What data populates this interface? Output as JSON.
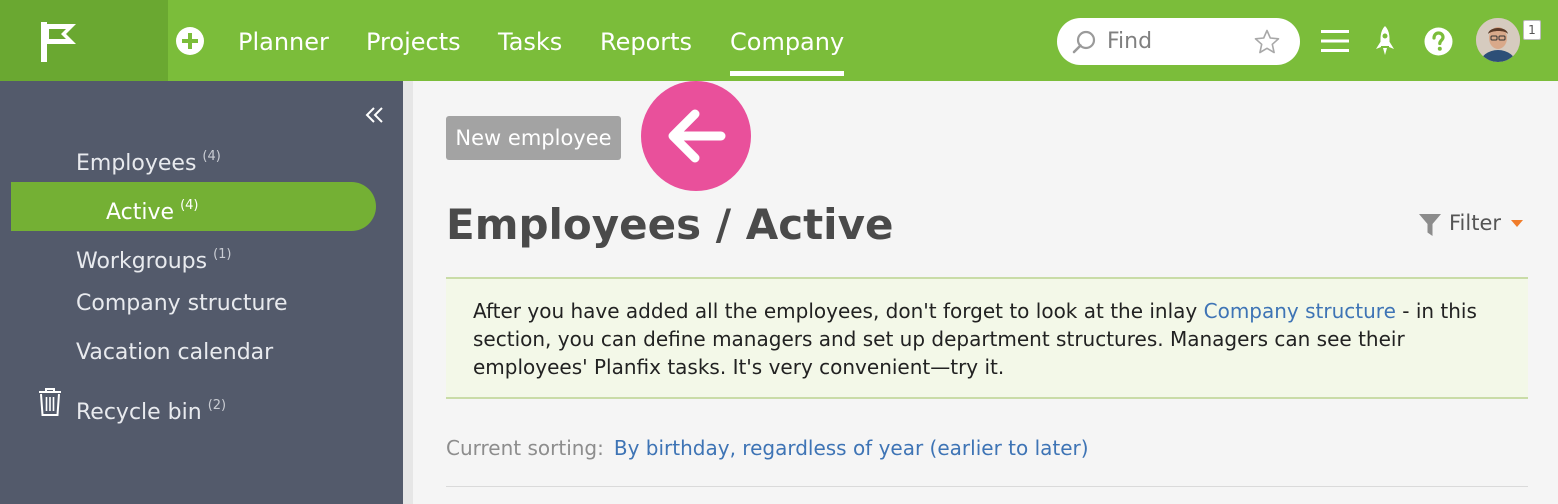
{
  "topbar": {
    "nav": [
      "Planner",
      "Projects",
      "Tasks",
      "Reports",
      "Company"
    ],
    "active_nav": "Company",
    "search_placeholder": "Find",
    "notification_count": "1",
    "colors": {
      "bar": "#7bbd3a",
      "logo_block": "#6aa831"
    }
  },
  "icons": {
    "logo": "planfix-flag-icon",
    "plus": "add-circle-icon",
    "search": "search-icon",
    "favorite": "star-icon",
    "menu": "hamburger-menu-icon",
    "launch": "rocket-icon",
    "help": "help-icon",
    "collapse": "double-chevron-left-icon",
    "trash": "trash-icon",
    "filter": "filter-funnel-icon",
    "back": "arrow-left-icon"
  },
  "sidebar": {
    "items": [
      {
        "label": "Employees",
        "count": "(4)"
      },
      {
        "label": "Active",
        "count": "(4)"
      },
      {
        "label": "Workgroups",
        "count": "(1)"
      },
      {
        "label": "Company structure",
        "count": ""
      },
      {
        "label": "Vacation calendar",
        "count": ""
      },
      {
        "label": "Recycle bin",
        "count": "(2)"
      }
    ],
    "active_index": 1,
    "colors": {
      "bg": "#535a6b",
      "active": "#74b034"
    }
  },
  "main": {
    "new_button": "New employee",
    "title": "Employees / Active",
    "filter_label": "Filter",
    "notice": {
      "before": "After you have added all the employees, don't forget to look at the inlay ",
      "link": "Company structure",
      "after": " - in this section, you can define managers and set up department structures. Managers can see their employees' Planfix tasks. It's very convenient—try it."
    },
    "sorting_label": "Current sorting:",
    "sorting_value": "By birthday, regardless of year (earlier to later)",
    "colors": {
      "accent_pink": "#e9509b",
      "link": "#3e74b5",
      "filter_caret": "#f07c2a"
    }
  }
}
